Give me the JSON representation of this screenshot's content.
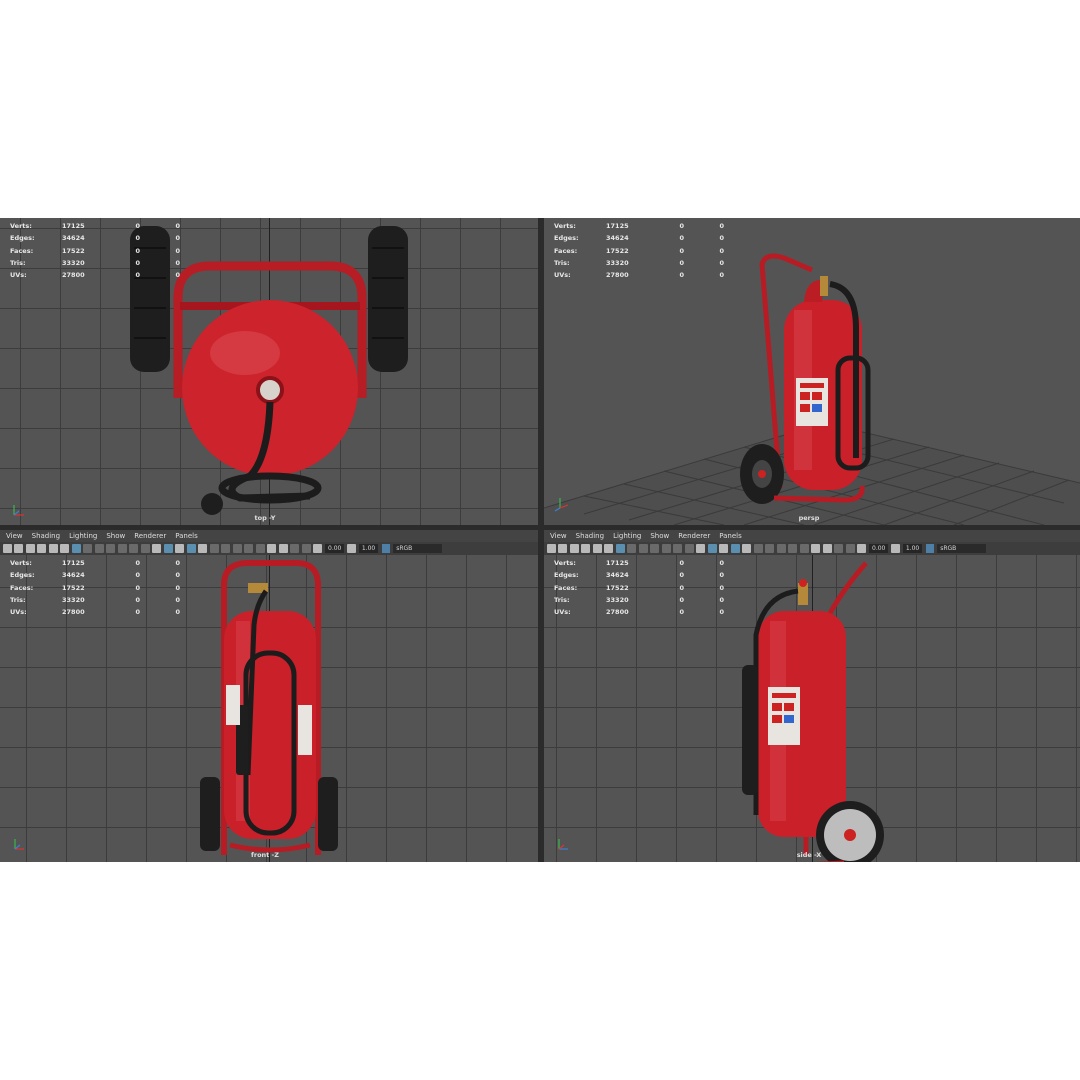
{
  "stats": {
    "labels": [
      "Verts:",
      "Edges:",
      "Faces:",
      "Tris:",
      "UVs:"
    ],
    "values": [
      "17125",
      "34624",
      "17522",
      "33320",
      "27800"
    ],
    "col_a": [
      "0",
      "0",
      "0",
      "0",
      "0"
    ],
    "col_b": [
      "0",
      "0",
      "0",
      "0",
      "0"
    ]
  },
  "panel_menu": {
    "items": [
      "View",
      "Shading",
      "Lighting",
      "Show",
      "Renderer",
      "Panels"
    ]
  },
  "toolbar": {
    "exposure": "0.00",
    "gamma_value": "1.00",
    "color_space": "sRGB gamma"
  },
  "viewports": {
    "top": {
      "camera": "top -Y"
    },
    "persp": {
      "camera": "persp"
    },
    "front": {
      "camera": "front -Z"
    },
    "side": {
      "camera": "side -X"
    }
  },
  "colors": {
    "viewport_bg": "#545454",
    "grid_line": "#3c3c3c",
    "extinguisher_red": "#c9202a",
    "tire": "#1e1e1e"
  },
  "icons": {
    "toolbar": [
      "camera-select-icon",
      "camera-attr-icon",
      "bookmark-icon",
      "image-plane-icon",
      "2d-pan-icon",
      "grease-pencil-icon",
      "grid-icon",
      "film-gate-icon",
      "resolution-gate-icon",
      "gate-mask-icon",
      "field-chart-icon",
      "safe-action-icon",
      "safe-title-icon",
      "wireframe-icon",
      "smooth-shade-icon",
      "default-material-icon",
      "textured-icon",
      "use-lights-icon",
      "shadows-icon",
      "ambient-occlusion-icon",
      "motion-blur-icon",
      "multisample-icon",
      "depth-of-field-icon",
      "isolate-select-icon",
      "xray-icon",
      "xray-joints-icon",
      "xray-components-icon",
      "exposure-icon",
      "gamma-icon",
      "view-transform-icon"
    ]
  }
}
